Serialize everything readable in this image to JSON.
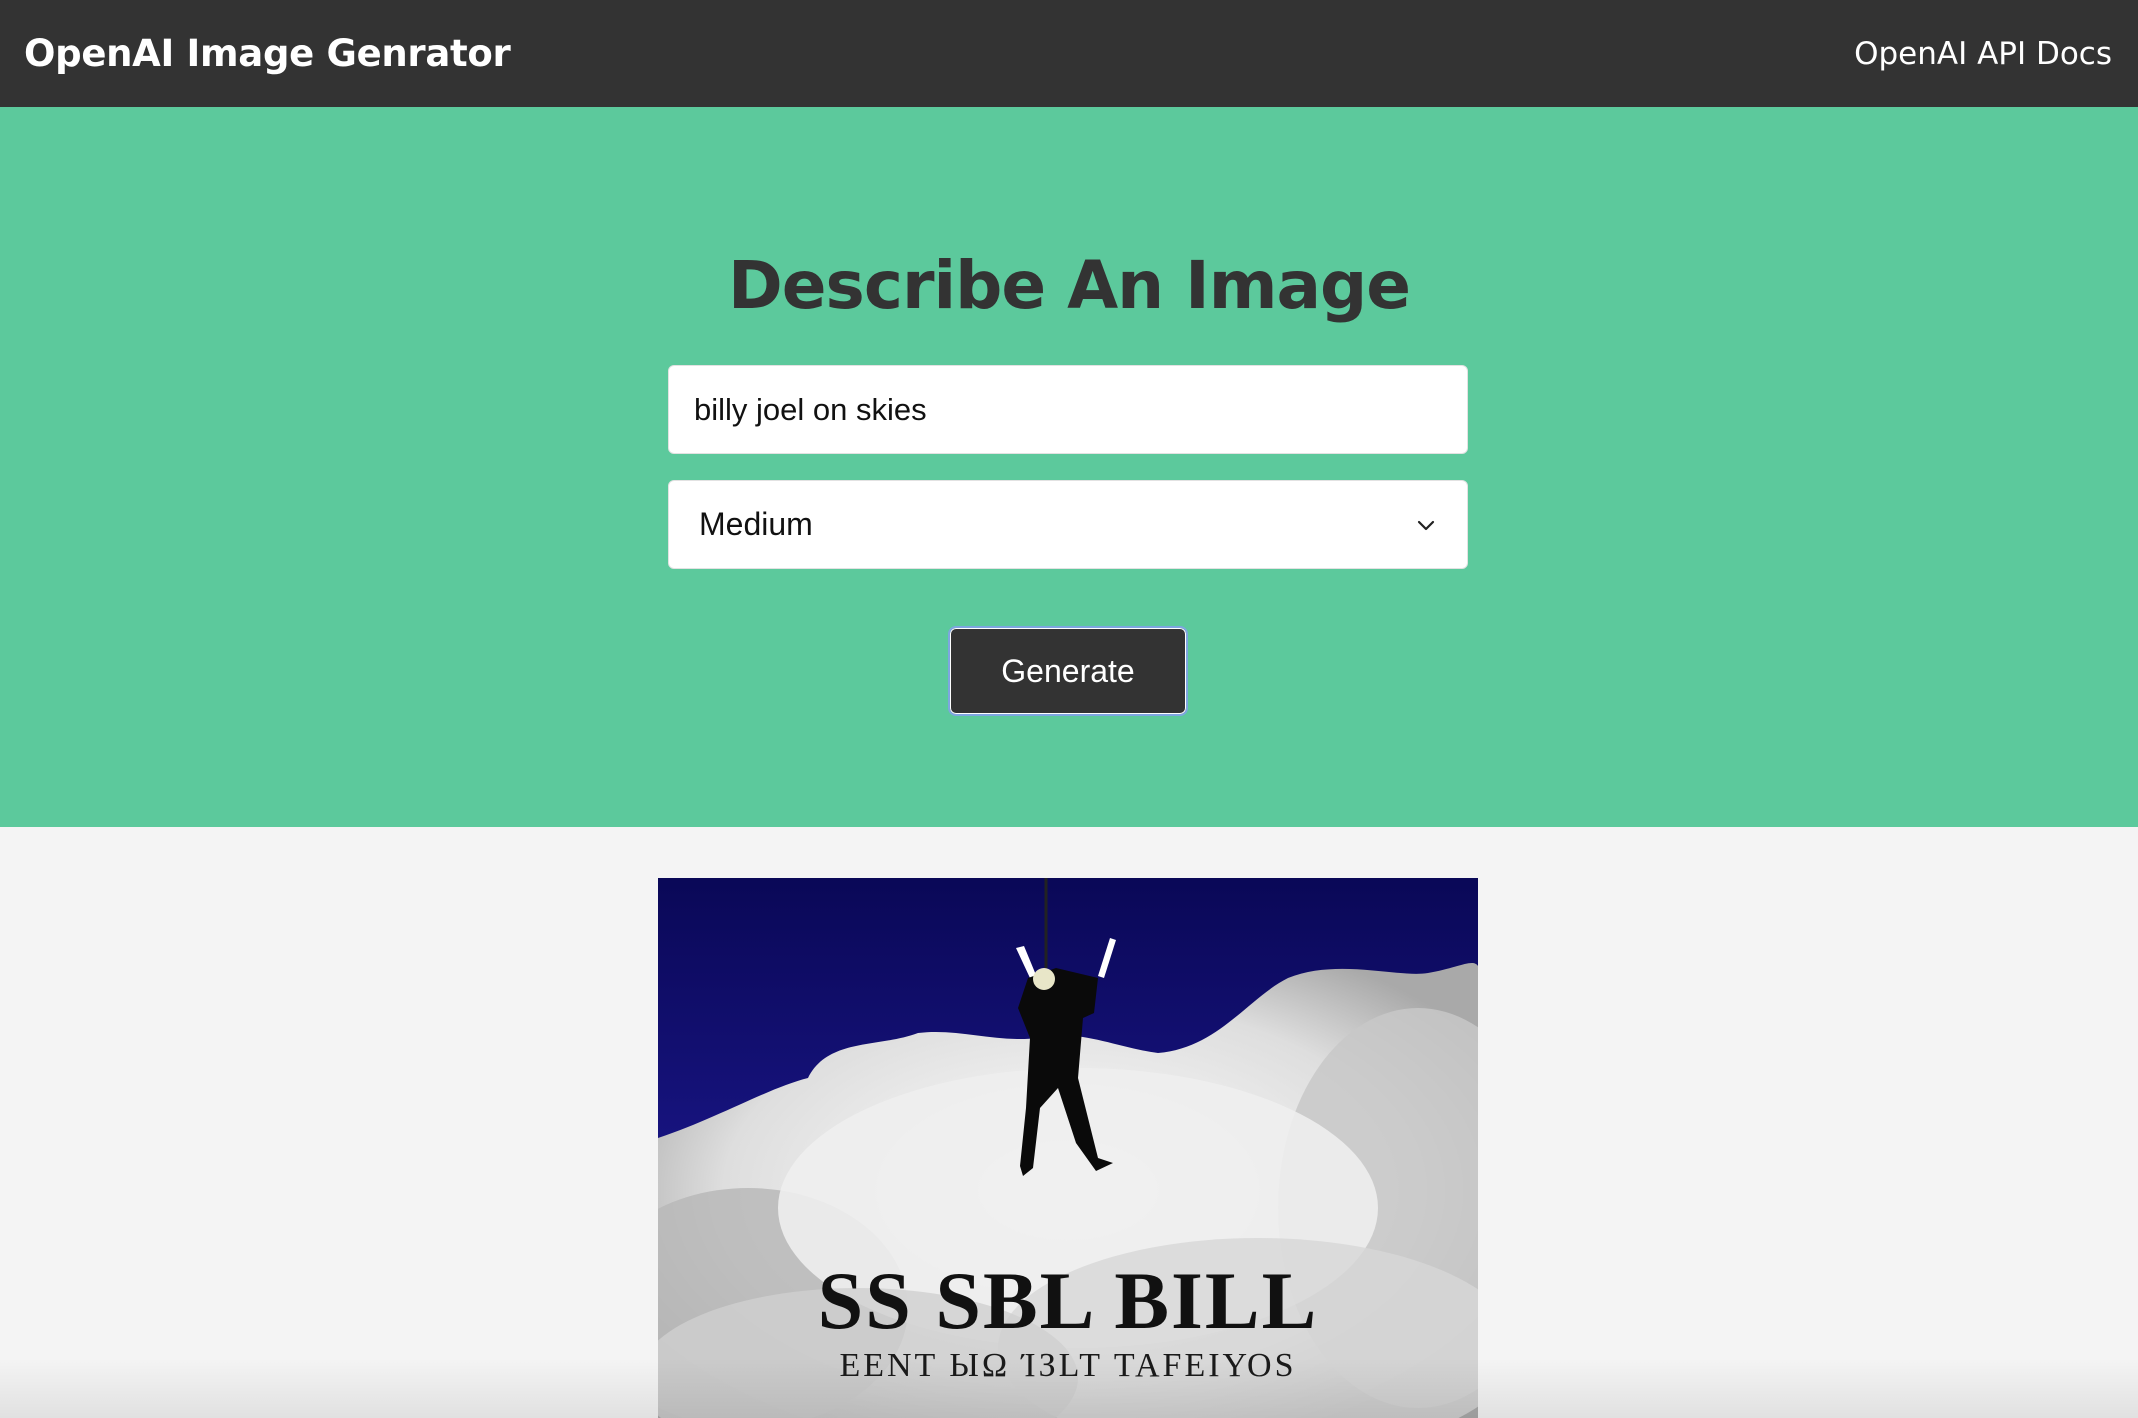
{
  "navbar": {
    "brand": "OpenAI Image Genrator",
    "docs_link": "OpenAI API Docs"
  },
  "showcase": {
    "heading": "Describe An Image",
    "prompt_value": "billy joel on skies",
    "size_selected": "Medium",
    "generate_label": "Generate"
  },
  "result": {
    "image_text_line1": "SS SBL BILL",
    "image_text_line2": "EENT ЫΩ ΊЗLT ΤΑFΕΙΥΟS"
  },
  "colors": {
    "navbar": "#333333",
    "showcase": "#5cc99c",
    "page_bg": "#f4f4f4",
    "button": "#333333"
  }
}
